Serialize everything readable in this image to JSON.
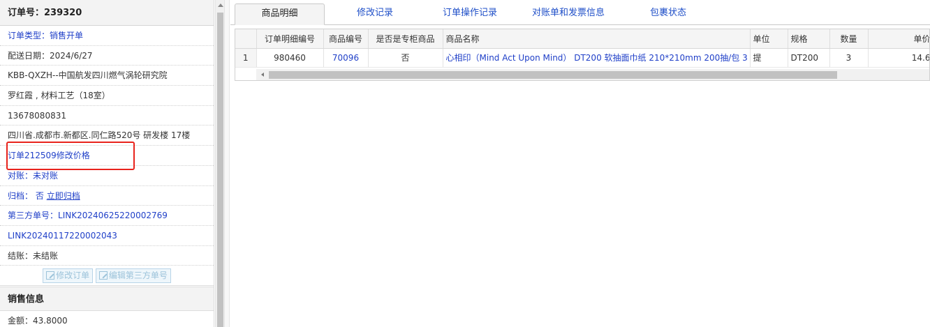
{
  "order": {
    "header": "订单号：239320",
    "type_line": "订单类型：销售开单",
    "delivery_date": "配送日期：2024/6/27",
    "customer": "KBB-QXZH--中国航发四川燃气涡轮研究院",
    "contact": "罗红霞 , 材料工艺（18室）",
    "phone": "13678080831",
    "address": "四川省.成都市.新都区.同仁路520号 研发楼 17楼",
    "price_change": "订单212509修改价格",
    "reconcile_label": "对账：",
    "reconcile_value": "未对账",
    "archive_label": "归档：",
    "archive_value": "否",
    "archive_link": "立即归档",
    "third_party_label": "第三方单号：",
    "third_party_1": "LINK20240625220002769",
    "third_party_2": "LINK20240117220002043",
    "settle": "结账：未结账",
    "btn_edit_order": "修改订单",
    "btn_edit_third": "编辑第三方单号",
    "sales_section": "销售信息",
    "amount": "金额：43.8000"
  },
  "tabs": [
    "商品明细",
    "修改记录",
    "订单操作记录",
    "对账单和发票信息",
    "包裹状态"
  ],
  "table": {
    "columns": [
      "",
      "订单明细编号",
      "商品编号",
      "是否是专柜商品",
      "商品名称",
      "单位",
      "规格",
      "数量",
      "单价"
    ],
    "rows": [
      [
        "1",
        "980460",
        "70096",
        "否",
        "心相印（Mind Act Upon Mind） DT200 软抽面巾纸 210*210mm 200抽/包 3",
        "提",
        "DT200",
        "3",
        "14.6"
      ]
    ]
  },
  "colors": {
    "link": "#1f3fc8",
    "highlight": "#e8231c"
  }
}
